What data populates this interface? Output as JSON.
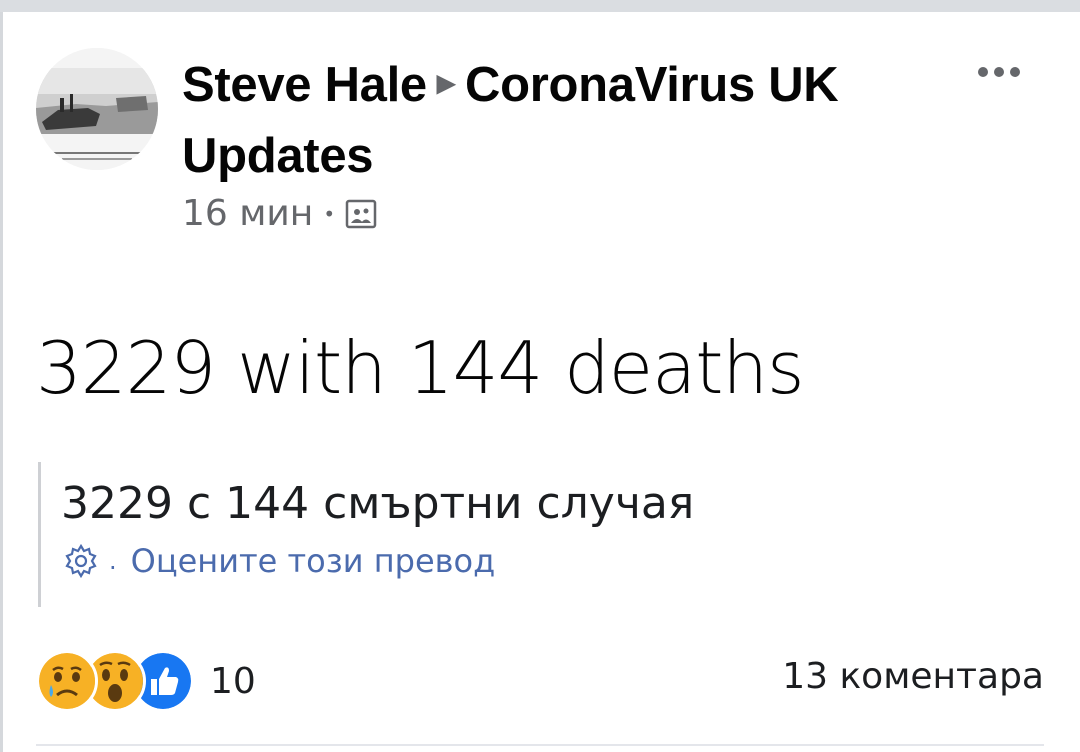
{
  "post": {
    "author": "Steve Hale",
    "group_line1": "CoronaVirus UK",
    "group_line2": "Updates",
    "time": "16 мин",
    "audience_icon": "group-audience-icon",
    "text": "3229 with 144 deaths"
  },
  "translation": {
    "text": "3229 с 144 смъртни случая",
    "rate_label": "Оцените този превод",
    "separator": "."
  },
  "reactions": {
    "types": [
      "sad",
      "wow",
      "like"
    ],
    "count": "10"
  },
  "comments": {
    "label": "13 коментара"
  },
  "colors": {
    "meta": "#65676b",
    "link": "#4b6bad",
    "like_blue": "#1877f2",
    "emoji_yellow": "#f7b125"
  }
}
